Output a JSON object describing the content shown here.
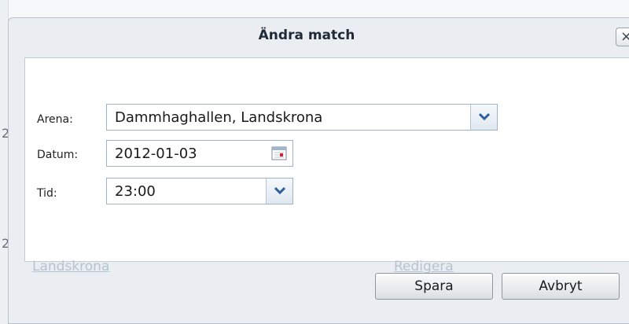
{
  "background": {
    "ghost_link_text": "Landskrona",
    "ghost_edit_text": "Redigera",
    "marker_top": "2",
    "marker_bottom": "2"
  },
  "dialog": {
    "title": "Ändra match",
    "close_glyph": "×",
    "fields": {
      "arena": {
        "label": "Arena:",
        "value": "Dammhaghallen, Landskrona"
      },
      "datum": {
        "label": "Datum:",
        "value": "2012-01-03"
      },
      "tid": {
        "label": "Tid:",
        "value": "23:00"
      }
    },
    "buttons": {
      "save": "Spara",
      "cancel": "Avbryt"
    }
  },
  "icons": {
    "dropdown": "chevron-down-icon",
    "calendar": "calendar-icon",
    "close": "close-icon"
  },
  "colors": {
    "dialog_bg": "#eaedf2",
    "field_border": "#9fb3c8",
    "chevron": "#2f5f9a"
  }
}
